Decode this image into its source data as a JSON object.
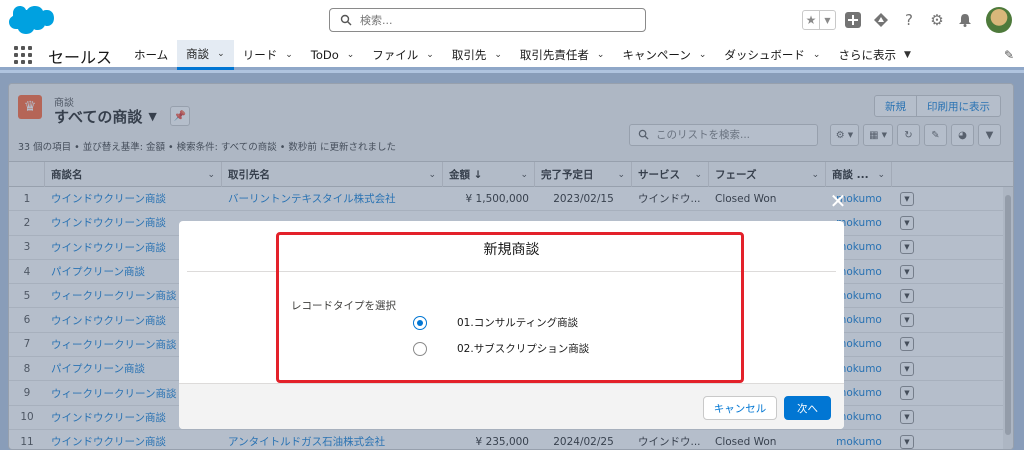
{
  "header": {
    "search_placeholder": "検索...",
    "icons": [
      "favorites-star-icon",
      "favorites-dropdown-icon",
      "add-icon",
      "trailhead-icon",
      "help-icon",
      "setup-gear-icon",
      "notifications-bell-icon",
      "avatar"
    ]
  },
  "nav": {
    "app_name": "セールス",
    "items": [
      {
        "label": "ホーム",
        "chevron": false
      },
      {
        "label": "商談",
        "chevron": true,
        "active": true
      },
      {
        "label": "リード",
        "chevron": true
      },
      {
        "label": "ToDo",
        "chevron": true
      },
      {
        "label": "ファイル",
        "chevron": true
      },
      {
        "label": "取引先",
        "chevron": true
      },
      {
        "label": "取引先責任者",
        "chevron": true
      },
      {
        "label": "キャンペーン",
        "chevron": true
      },
      {
        "label": "ダッシュボード",
        "chevron": true
      },
      {
        "label": "さらに表示",
        "chevron": true
      }
    ]
  },
  "list": {
    "object_label": "商談",
    "title": "すべての商談",
    "meta": "33 個の項目 • 並び替え基準: 金額 • 検索条件: すべての商談 • 数秒前 に更新されました",
    "new_button": "新規",
    "print_button": "印刷用に表示",
    "search_placeholder": "このリストを検索...",
    "columns": [
      "商談名",
      "取引先名",
      "金額 ↓",
      "完了予定日",
      "サービス",
      "フェーズ",
      "商談 ..."
    ],
    "rows": [
      {
        "no": "1",
        "name": "ウインドウクリーン商談",
        "account": "バーリントンテキスタイル株式会社",
        "amount": "¥ 1,500,000",
        "date": "2023/02/15",
        "service": "ウインドウ...",
        "phase": "Closed Won",
        "owner": "mokumo"
      },
      {
        "no": "2",
        "name": "ウインドウクリーン商談",
        "account": "",
        "amount": "",
        "date": "",
        "service": "",
        "phase": "",
        "owner": "mokumo"
      },
      {
        "no": "3",
        "name": "ウインドウクリーン商談",
        "account": "",
        "amount": "",
        "date": "",
        "service": "",
        "phase": "",
        "owner": "mokumo"
      },
      {
        "no": "4",
        "name": "パイプクリーン商談",
        "account": "",
        "amount": "",
        "date": "",
        "service": "",
        "phase": "",
        "owner": "mokumo"
      },
      {
        "no": "5",
        "name": "ウィークリークリーン商談",
        "account": "",
        "amount": "",
        "date": "",
        "service": "",
        "phase": "",
        "owner": "mokumo"
      },
      {
        "no": "6",
        "name": "ウインドウクリーン商談",
        "account": "",
        "amount": "",
        "date": "",
        "service": "",
        "phase": "",
        "owner": "mokumo"
      },
      {
        "no": "7",
        "name": "ウィークリークリーン商談",
        "account": "",
        "amount": "",
        "date": "",
        "service": "",
        "phase": "",
        "owner": "mokumo"
      },
      {
        "no": "8",
        "name": "パイプクリーン商談",
        "account": "",
        "amount": "",
        "date": "",
        "service": "",
        "phase": "",
        "owner": "mokumo"
      },
      {
        "no": "9",
        "name": "ウィークリークリーン商談",
        "account": "",
        "amount": "",
        "date": "",
        "service": "",
        "phase": "",
        "owner": "mokumo"
      },
      {
        "no": "10",
        "name": "ウインドウクリーン商談",
        "account": "",
        "amount": "",
        "date": "",
        "service": "",
        "phase": "",
        "owner": "mokumo"
      },
      {
        "no": "11",
        "name": "ウインドウクリーン商談",
        "account": "アンタイトルドガス石油株式会社",
        "amount": "¥ 235,000",
        "date": "2024/02/25",
        "service": "ウインドウ...",
        "phase": "Closed Won",
        "owner": "mokumo"
      }
    ]
  },
  "modal": {
    "title": "新規商談",
    "record_type_label": "レコードタイプを選択",
    "options": [
      {
        "label": "01.コンサルティング商談",
        "checked": true
      },
      {
        "label": "02.サブスクリプション商談",
        "checked": false
      }
    ],
    "cancel_label": "キャンセル",
    "next_label": "次へ",
    "close_symbol": "✕"
  },
  "colors": {
    "brand_blue": "#0176d3",
    "opportunity_icon": "#ff5d2d",
    "highlight_red": "#e3212a"
  }
}
